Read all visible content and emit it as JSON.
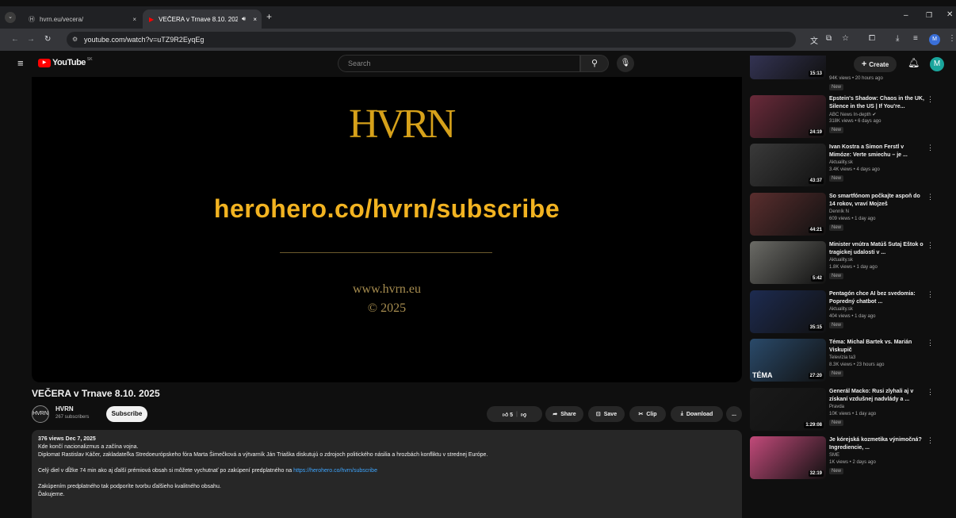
{
  "browser": {
    "tabs": [
      {
        "title": "hvrn.eu/vecera/",
        "close": "×"
      },
      {
        "title": "VEČERA v Trnave 8.10. 2025",
        "close": "×"
      }
    ],
    "new_tab": "+",
    "url": "youtube.com/watch?v=uTZ9R2EyqEg",
    "profile_initial": "M"
  },
  "yt": {
    "logo_text": "YouTube",
    "logo_region": "SK",
    "search_placeholder": "Search",
    "create_label": "Create",
    "avatar_initial": "M"
  },
  "player": {
    "logo_text": "HVRN",
    "subscribe_url": "herohero.co/hvrn/subscribe",
    "website": "www.hvrn.eu",
    "copyright": "© 2025"
  },
  "video": {
    "title": "VEČERA v Trnave 8.10. 2025",
    "channel": "HVRN",
    "channel_avatar": "HVRN",
    "subscribers": "267 subscribers",
    "subscribe_label": "Subscribe",
    "likes": "5",
    "share_label": "Share",
    "save_label": "Save",
    "clip_label": "Clip",
    "download_label": "Download",
    "more_label": "..."
  },
  "description": {
    "stats": "376 views  Dec 7, 2025",
    "line1": "Kde končí nacionalizmus a začína vojna.",
    "line2": "Diplomat Rastislav Káčer, zakladateľka Stredoeurópskeho fóra Marta Šimečková a výtvarník Ján Triaška diskutujú o zdrojoch politického násilia a hrozbách konfliktu v strednej Európe.",
    "line3": "Celý diel v dĺžke 74 min ako aj ďalší prémiová obsah si môžete vychutnať po zakúpení predplatného na",
    "link": "https://herohero.co/hvrn/subscribe",
    "line4": "Zakúpením predplatného tak podporíte tvorbu ďalšieho kvalitného obsahu.",
    "line5": "Ďakujeme."
  },
  "recommendations": [
    {
      "title": "",
      "channel": "",
      "meta": "94K views • 20 hours ago",
      "new": "New",
      "duration": "15:13",
      "color": "#3a3a60"
    },
    {
      "title": "Epstein's Shadow: Chaos in the UK, Silence in the US | If You're...",
      "channel": "ABC News In-depth ✔",
      "meta": "318K views • 6 days ago",
      "new": "New",
      "duration": "24:19",
      "color": "#6a2a3a"
    },
    {
      "title": "Ivan Kostra a Šimon Ferstl v Mimóze: Verte smiechu – je ...",
      "channel": "Aktuality.sk",
      "meta": "3.4K views • 4 days ago",
      "new": "New",
      "duration": "43:37",
      "color": "#3a3a3a"
    },
    {
      "title": "So smartfónom počkajte aspoň do 14 rokov, vraví Mojzeš",
      "channel": "Denník N",
      "meta": "609 views • 1 day ago",
      "new": "New",
      "duration": "44:21",
      "color": "#5a2e2e"
    },
    {
      "title": "Minister vnútra Matúš Šutaj Eštok o tragickej udalosti v ...",
      "channel": "Aktuality.sk",
      "meta": "1.8K views • 1 day ago",
      "new": "New",
      "duration": "5:42",
      "color": "#6b6b66"
    },
    {
      "title": "Pentagón chce AI bez svedomia: Popredný chatbot ...",
      "channel": "Aktuality.sk",
      "meta": "404 views • 1 day ago",
      "new": "New",
      "duration": "35:15",
      "color": "#1d2b50"
    },
    {
      "title": "Téma: Michal Bartek vs. Marián Viskupič",
      "channel": "Televízia ta3",
      "meta": "8.3K views • 23 hours ago",
      "new": "New",
      "duration": "27:20",
      "color": "#2a4a6a",
      "overlay": "TÉMA"
    },
    {
      "title": "Generál Macko: Rusi zlyhali aj v získaní vzdušnej nadvlády a ...",
      "channel": "Pravda",
      "meta": "10K views • 1 day ago",
      "new": "New",
      "duration": "1:29:08",
      "color": "#1a1a1a"
    },
    {
      "title": "Je kórejská kozmetika výnimočná? Ingrediencie, ...",
      "channel": "SME",
      "meta": "1K views • 2 days ago",
      "new": "New",
      "duration": "32:19",
      "color": "#c24a7a"
    }
  ],
  "colors": {
    "accent": "#f2b321",
    "yt_red": "#ff0000",
    "link": "#3ea6ff"
  }
}
